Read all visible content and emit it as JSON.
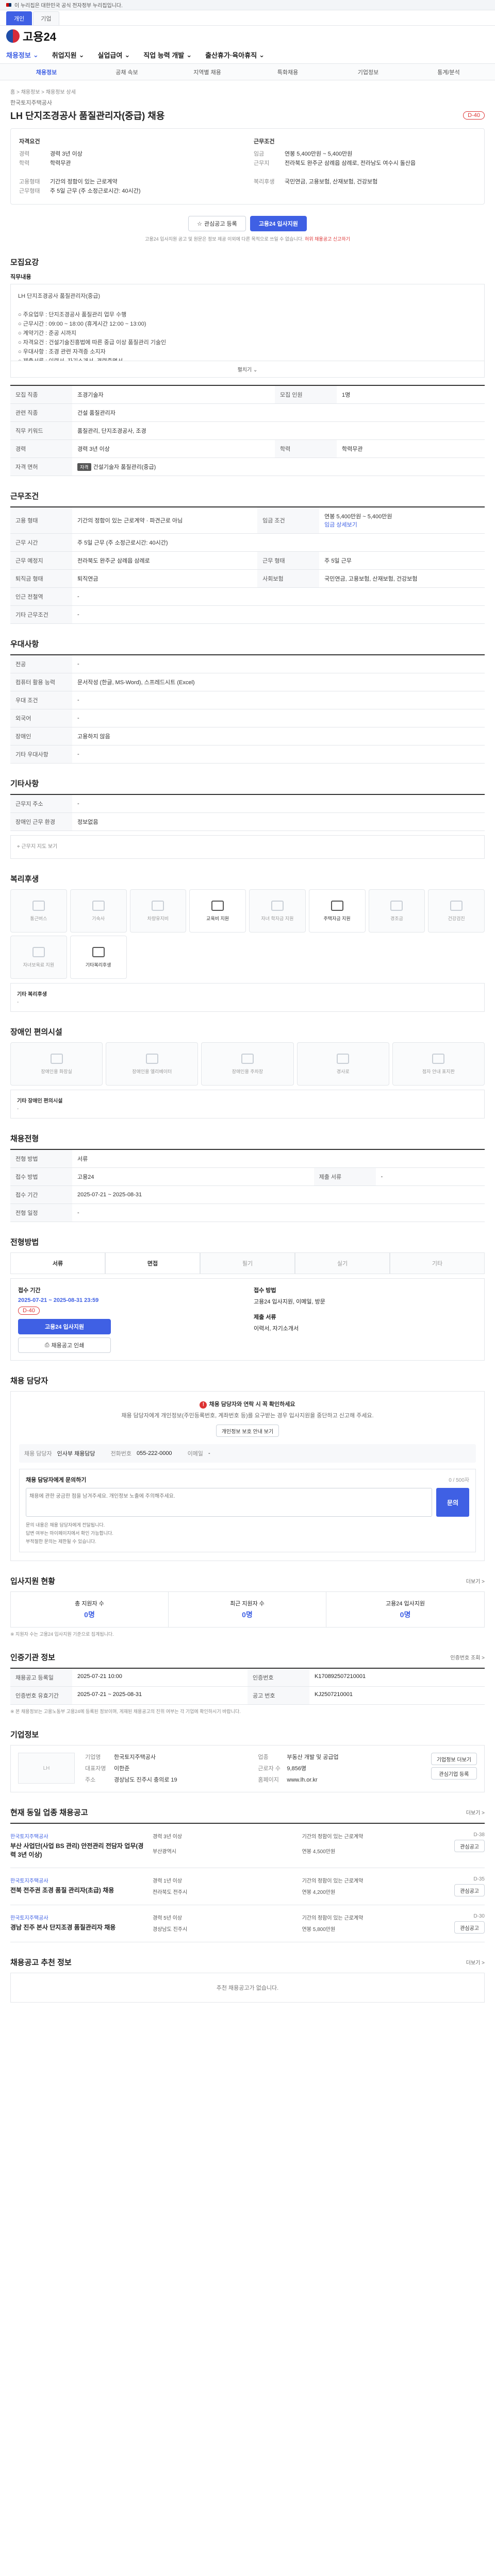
{
  "gov_banner": "이 누리집은 대한민국 공식 전자정부 누리집입니다.",
  "tabs": [
    "개인",
    "기업"
  ],
  "logo": "고용24",
  "gnb": [
    "채용정보",
    "취업지원",
    "실업급여",
    "직업 능력 개발",
    "출산휴가·육아휴직"
  ],
  "lnb": [
    "채용정보",
    "공채 속보",
    "지역별 채용",
    "특화채용",
    "기업정보",
    "통계/분석"
  ],
  "crumbs": "홈 > 채용정보 > 채용정보 상세",
  "company": "한국토지주택공사",
  "title": "LH 단지조경공사 품질관리자(중급) 채용",
  "dday": "D-40",
  "summary": {
    "left_head": "자격요건",
    "left": [
      {
        "k": "경력",
        "v": "경력 3년 이상"
      },
      {
        "k": "학력",
        "v": "학력무관"
      },
      {
        "k": "",
        "v": ""
      },
      {
        "k": "고용형태",
        "v": "기간의 정함이 있는 근로계약"
      },
      {
        "k": "근무형태",
        "v": "주 5일 근무 (주 소정근로시간: 40시간)"
      }
    ],
    "right_head": "근무조건",
    "right": [
      {
        "k": "임금",
        "v": "연봉 5,400만원 ~ 5,400만원"
      },
      {
        "k": "근무지",
        "v": "전라북도 완주군 삼례읍 삼례로, 전라남도 여수시 돌산읍"
      },
      {
        "k": "",
        "v": ""
      },
      {
        "k": "복리후생",
        "v": "국민연금, 고용보험, 산재보험, 건강보험"
      }
    ]
  },
  "actions": {
    "bookmark": "관심공고 등록",
    "apply": "고용24 입사지원"
  },
  "notice_pre": "고용24 입사지원 공고 및 원문은 정보 제공 이외에 다른 목적으로 쓰일 수 없습니다.",
  "notice_red": "허위 채용공고 신고하기",
  "recruit": {
    "title": "모집요강",
    "desc_title": "직무내용",
    "desc": "LH 단지조경공사 품질관리자(중급)\n\n○ 주요업무 : 단지조경공사 품질관리 업무 수행\n○ 근무시간 : 09:00 ~ 18:00 (휴게시간 12:00 ~ 13:00)\n○ 계약기간 : 준공 시까지\n○ 자격요건 : 건설기술진흥법에 따른 중급 이상 품질관리 기술인\n○ 우대사항 : 조경 관련 자격증 소지자\n○ 제출서류 : 이력서, 자기소개서, 경력증명서",
    "fold": "펼치기",
    "rows": [
      {
        "k": "모집 직종",
        "v": "조경기술자",
        "k2": "모집 인원",
        "v2": "1명"
      },
      {
        "k": "관련 직종",
        "v": "건설 품질관리자",
        "k2": "",
        "v2": ""
      },
      {
        "k": "직무 키워드",
        "v": "품질관리, 단지조경공사, 조경",
        "k2": "",
        "v2": ""
      },
      {
        "k": "경력",
        "v": "경력 3년 이상",
        "k2": "학력",
        "v2": "학력무관"
      },
      {
        "k": "자격 면허",
        "v": "건설기술자 품질관리(중급)",
        "k2": "",
        "v2": ""
      }
    ]
  },
  "conditions": {
    "title": "근무조건",
    "rows": [
      {
        "k": "고용 형태",
        "v": "기간의 정함이 있는 근로계약 · 파견근로 아님",
        "k2": "임금 조건",
        "v2": "연봉 5,400만원 ~ 5,400만원",
        "v2b": "임금 상세보기"
      },
      {
        "k": "근무 시간",
        "v": "주 5일 근무 (주 소정근로시간: 40시간)",
        "k2": "",
        "v2": ""
      },
      {
        "k": "근무 예정지",
        "v": "전라북도 완주군 삼례읍 삼례로",
        "k2": "근무 형태",
        "v2": "주 5일 근무"
      },
      {
        "k": "퇴직금 형태",
        "v": "퇴직연금",
        "k2": "사회보험",
        "v2": "국민연금, 고용보험, 산재보험, 건강보험"
      },
      {
        "k": "인근 전철역",
        "v": "-",
        "k2": "",
        "v2": ""
      },
      {
        "k": "기타 근무조건",
        "v": "-",
        "k2": "",
        "v2": ""
      }
    ]
  },
  "qual": {
    "title": "우대사항",
    "rows": [
      {
        "k": "전공",
        "v": "-"
      },
      {
        "k": "컴퓨터 활용 능력",
        "v": "문서작성 (한글, MS-Word), 스프레드시트 (Excel)"
      },
      {
        "k": "우대 조건",
        "v": "-"
      },
      {
        "k": "외국어",
        "v": "-"
      },
      {
        "k": "장애인",
        "v": "고용하지 않음"
      },
      {
        "k": "기타 우대사항",
        "v": "-"
      }
    ]
  },
  "etc": {
    "title": "기타사항",
    "rows": [
      {
        "k": "근무지 주소",
        "v": "-"
      },
      {
        "k": "장애인 근무 환경",
        "v": "정보없음"
      }
    ],
    "map_label": "근무지 지도 보기"
  },
  "welfare": {
    "title": "복리후생",
    "items": [
      "통근버스",
      "기숙사",
      "차량유지비",
      "교육비 지원",
      "자녀 학자금 지원",
      "주택자금 지원",
      "경조금",
      "건강검진",
      "자녀보육료 지원",
      "기타복리후생"
    ],
    "active": [
      3,
      5,
      9
    ],
    "extra_label": "기타 복리후생",
    "extra_value": "-"
  },
  "disability": {
    "title": "장애인 편의시설",
    "items": [
      "장애인용 화장실",
      "장애인용 엘리베이터",
      "장애인용 주차장",
      "경사로",
      "점자 안내 표지판"
    ],
    "extra_label": "기타 장애인 편의시설",
    "extra_value": "-"
  },
  "selection": {
    "title": "채용전형",
    "rows": [
      {
        "k": "전형 방법",
        "v": "서류"
      },
      {
        "k": "접수 방법",
        "v": "고용24",
        "k2": "제출 서류",
        "v2": "-"
      },
      {
        "k": "접수 기간",
        "v": "2025-07-21 ~ 2025-08-31",
        "k2": "",
        "v2": ""
      },
      {
        "k": "전형 일정",
        "v": "-",
        "k2": "",
        "v2": ""
      }
    ]
  },
  "process": {
    "title": "전형방법",
    "steps": [
      "서류",
      "면접",
      "필기",
      "실기",
      "기타"
    ],
    "active": [
      0,
      1
    ],
    "recv_head": "접수 기간",
    "recv_date": "2025-07-21 ~ 2025-08-31 23:59",
    "recv_badge": "D-40",
    "apply_btn": "고용24 입사지원",
    "print_btn": "채용공고 인쇄",
    "method_head": "접수 방법",
    "method_v": "고용24 입사지원, 이메일, 방문",
    "doc_head": "제출 서류",
    "doc_v": "이력서, 자기소개서"
  },
  "contact": {
    "title": "채용 담당자",
    "alert_head": "채용 담당자와 연락 시 꼭 확인하세요",
    "alert_body": "채용 담당자에게 개인정보(주민등록번호, 계좌번호 등)를 요구받는 경우 입사지원을 중단하고 신고해 주세요.",
    "alert_btn": "개인정보 보호 안내 보기",
    "name_label": "채용 담당자",
    "name_value": "인사부 채용담당",
    "phone_label": "전화번호",
    "phone_value": "055-222-0000",
    "email_label": "이메일",
    "email_value": "-",
    "inq_head": "채용 담당자에게 문의하기",
    "inq_placeholder": "채용에 관한 궁금한 점을 남겨주세요. 개인정보 노출에 주의해주세요.",
    "inq_send": "문의",
    "inq_count": "0 / 500자",
    "notes": [
      "문의 내용은 채용 담당자에게 전달됩니다.",
      "답변 여부는 마이페이지에서 확인 가능합니다.",
      "부적절한 문의는 제한될 수 있습니다."
    ]
  },
  "status": {
    "title": "입사지원 현황",
    "more": "더보기 >",
    "cols": [
      {
        "k": "총 지원자 수",
        "v": "0명"
      },
      {
        "k": "최근 지원자 수",
        "v": "0명"
      },
      {
        "k": "고용24 입사지원",
        "v": "0명"
      }
    ],
    "note": "※ 지원자 수는 고용24 입사지원 기준으로 집계됩니다."
  },
  "info": {
    "title": "인증기관 정보",
    "more": "인증번호 조회 >",
    "rows": [
      {
        "k": "채용공고 등록일",
        "v": "2025-07-21 10:00",
        "k2": "인증번호",
        "v2": "K170892507210001"
      },
      {
        "k": "인증번호 유효기간",
        "v": "2025-07-21 ~ 2025-08-31",
        "k2": "공고 번호",
        "v2": "KJ2507210001"
      }
    ],
    "note": "※ 본 채용정보는 고용노동부 고용24에 등록된 정보이며, 게재된 채용공고의 진위 여부는 각 기업에 확인하시기 바랍니다."
  },
  "company_info": {
    "title": "기업정보",
    "logo_placeholder": "LH",
    "rows": [
      {
        "k": "기업명",
        "v": "한국토지주택공사"
      },
      {
        "k": "업종",
        "v": "부동산 개발 및 공급업"
      },
      {
        "k": "대표자명",
        "v": "이한준"
      },
      {
        "k": "근로자 수",
        "v": "9,856명"
      },
      {
        "k": "주소",
        "v": "경상남도 진주시 충의로 19"
      },
      {
        "k": "홈페이지",
        "v": "www.lh.or.kr"
      }
    ],
    "btn1": "기업정보 더보기",
    "btn2": "관심기업 등록"
  },
  "related": {
    "title": "현재 동일 업종 채용공고",
    "more": "더보기 >",
    "items": [
      {
        "co": "한국토지주택공사",
        "t": "부산 사업단(사업 BS 관리) 안전관리 전담자 업무(경력 3년 이상)",
        "a": "경력 3년 이상",
        "b": "기간의 정함이 있는 근로계약",
        "c": "부산광역시",
        "d": "연봉 4,500만원",
        "e": "D-38",
        "f": "관심공고"
      },
      {
        "co": "한국토지주택공사",
        "t": "전북 전주권 조경 품질 관리자(초급) 채용",
        "a": "경력 1년 이상",
        "b": "기간의 정함이 있는 근로계약",
        "c": "전라북도 전주시",
        "d": "연봉 4,200만원",
        "e": "D-35",
        "f": "관심공고"
      },
      {
        "co": "한국토지주택공사",
        "t": "경남 진주 본사 단지조경 품질관리자 채용",
        "a": "경력 5년 이상",
        "b": "기간의 정함이 있는 근로계약",
        "c": "경상남도 진주시",
        "d": "연봉 5,800만원",
        "e": "D-30",
        "f": "관심공고"
      }
    ]
  },
  "recommend": {
    "title": "채용공고 추천 정보",
    "more": "더보기 >",
    "empty": "추천 채용공고가 없습니다."
  }
}
